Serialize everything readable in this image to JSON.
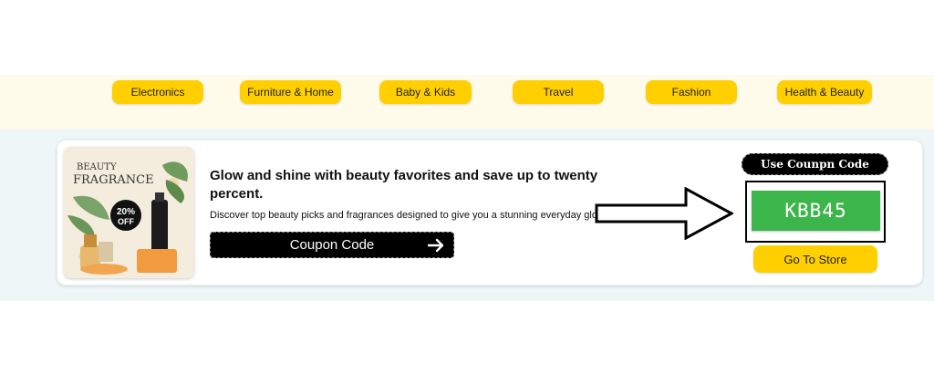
{
  "categories": [
    {
      "label": "Electronics"
    },
    {
      "label": "Furniture & Home"
    },
    {
      "label": "Baby & Kids"
    },
    {
      "label": "Travel"
    },
    {
      "label": "Fashion"
    },
    {
      "label": "Health & Beauty"
    }
  ],
  "offer": {
    "title": "Glow and shine with beauty favorites and save up to twenty percent.",
    "description": "Discover top beauty picks and fragrances designed to give you a stunning everyday glow.",
    "coupon_button_label": "Coupon Code",
    "use_code_label": "Use Counpn Code",
    "code": "KBB45",
    "store_button_label": "Go To Store",
    "thumbnail": {
      "heading_line1": "BEAUTY",
      "heading_line2": "FRAGRANCE",
      "badge_line1": "20%",
      "badge_line2": "OFF"
    }
  },
  "colors": {
    "category_button": "#ffcf00",
    "code_box": "#3cb54a",
    "band_top": "#fffbea",
    "band_content": "#eef6f8"
  }
}
